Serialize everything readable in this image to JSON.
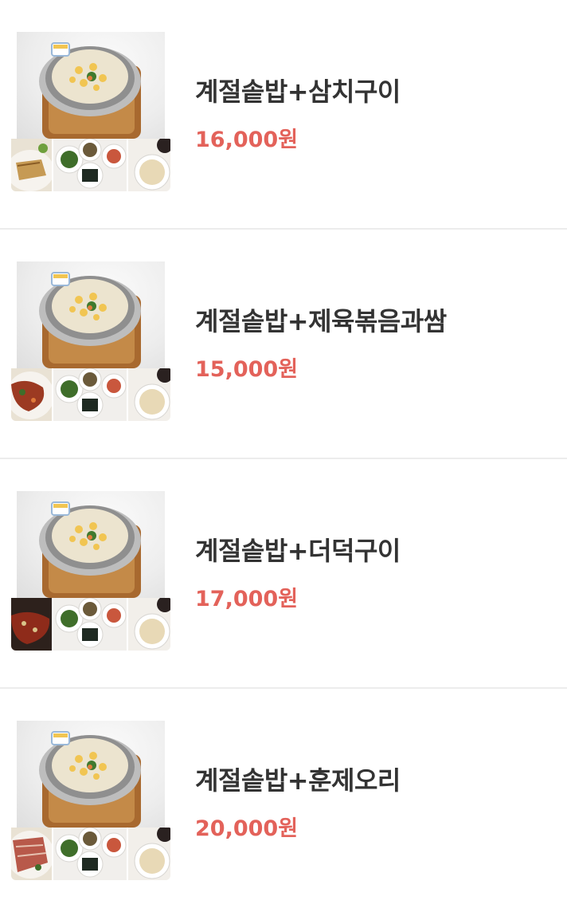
{
  "menu": {
    "items": [
      {
        "name": "계절솥밥+삼치구이",
        "price": "16,000원",
        "side_dish": "grilled-fish"
      },
      {
        "name": "계절솥밥+제육볶음과쌈",
        "price": "15,000원",
        "side_dish": "spicy-pork"
      },
      {
        "name": "계절솥밥+더덕구이",
        "price": "17,000원",
        "side_dish": "grilled-deodeok"
      },
      {
        "name": "계절솥밥+훈제오리",
        "price": "20,000원",
        "side_dish": "smoked-duck"
      }
    ]
  },
  "colors": {
    "name_text": "#333333",
    "price_text": "#e3625a",
    "divider": "#ececec",
    "background": "#ffffff"
  }
}
